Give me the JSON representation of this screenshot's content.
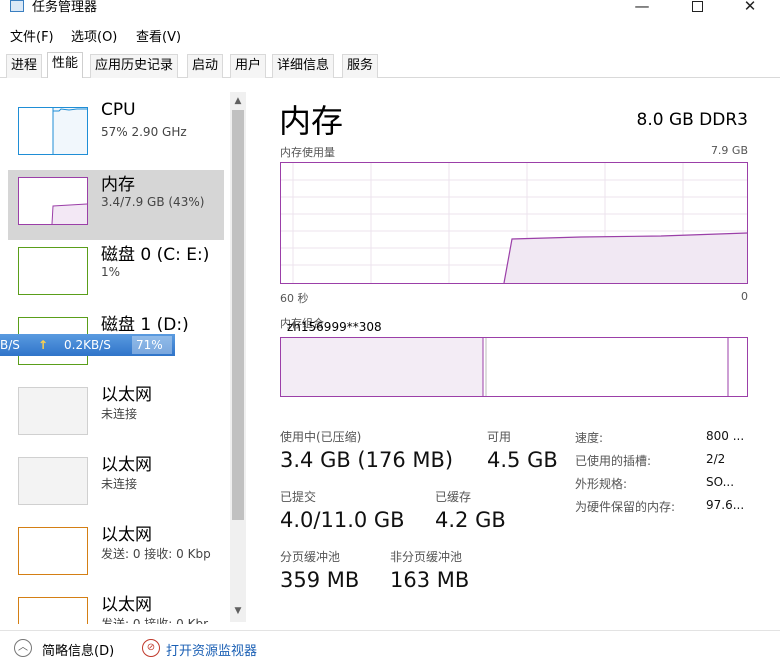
{
  "window": {
    "title": "任务管理器",
    "min_glyph": "—",
    "close_glyph": "✕"
  },
  "menu": [
    "文件(F)",
    "选项(O)",
    "查看(V)"
  ],
  "tabs": [
    {
      "label": "进程"
    },
    {
      "label": "性能",
      "active": true
    },
    {
      "label": "应用历史记录"
    },
    {
      "label": "启动"
    },
    {
      "label": "用户"
    },
    {
      "label": "详细信息"
    },
    {
      "label": "服务"
    }
  ],
  "resources": [
    {
      "name": "CPU",
      "sub": "57% 2.90 GHz",
      "color": "#1f8ed6"
    },
    {
      "name": "内存",
      "sub": "3.4/7.9 GB (43%)",
      "color": "#9b3fa8",
      "selected": true
    },
    {
      "name": "磁盘 0 (C: E:)",
      "sub": "1%",
      "color": "#5a9e1a"
    },
    {
      "name": "磁盘 1 (D:)",
      "sub": "",
      "color": "#5a9e1a"
    },
    {
      "name": "以太网",
      "sub": "未连接",
      "color": "#cfcfcf"
    },
    {
      "name": "以太网",
      "sub": "未连接",
      "color": "#cfcfcf"
    },
    {
      "name": "以太网",
      "sub": "发送: 0 接收: 0 Kbp",
      "color": "#d47f14"
    },
    {
      "name": "以太网",
      "sub": "发送: 0 接收: 0 Kbr",
      "color": "#d47f14"
    }
  ],
  "net_overlay": {
    "left": "B/S",
    "arrow": "↑",
    "speed": "0.2KB/S",
    "percent": "71%"
  },
  "detail": {
    "title": "内存",
    "spec": "8.0 GB DDR3",
    "usage_label": "内存使用量",
    "usage_max": "7.9 GB",
    "time_left": "60 秒",
    "time_right": "0",
    "composition_label": "内存组合",
    "stats": {
      "in_use_label": "使用中(已压缩)",
      "in_use_value": "3.4 GB (176 MB)",
      "available_label": "可用",
      "available_value": "4.5 GB",
      "committed_label": "已提交",
      "committed_value": "4.0/11.0 GB",
      "cached_label": "已缓存",
      "cached_value": "4.2 GB",
      "paged_label": "分页缓冲池",
      "paged_value": "359 MB",
      "nonpaged_label": "非分页缓冲池",
      "nonpaged_value": "163 MB"
    },
    "side": [
      {
        "label": "速度:",
        "value": "800 ..."
      },
      {
        "label": "已使用的插槽:",
        "value": "2/2"
      },
      {
        "label": "外形规格:",
        "value": "SO..."
      },
      {
        "label": "为硬件保留的内存:",
        "value": "97.6..."
      }
    ]
  },
  "watermark": "zh156999**308",
  "footer": {
    "summary_icon": "︿",
    "summary": "简略信息(D)",
    "monitor_icon": "⊘",
    "monitor": "打开资源监视器"
  }
}
